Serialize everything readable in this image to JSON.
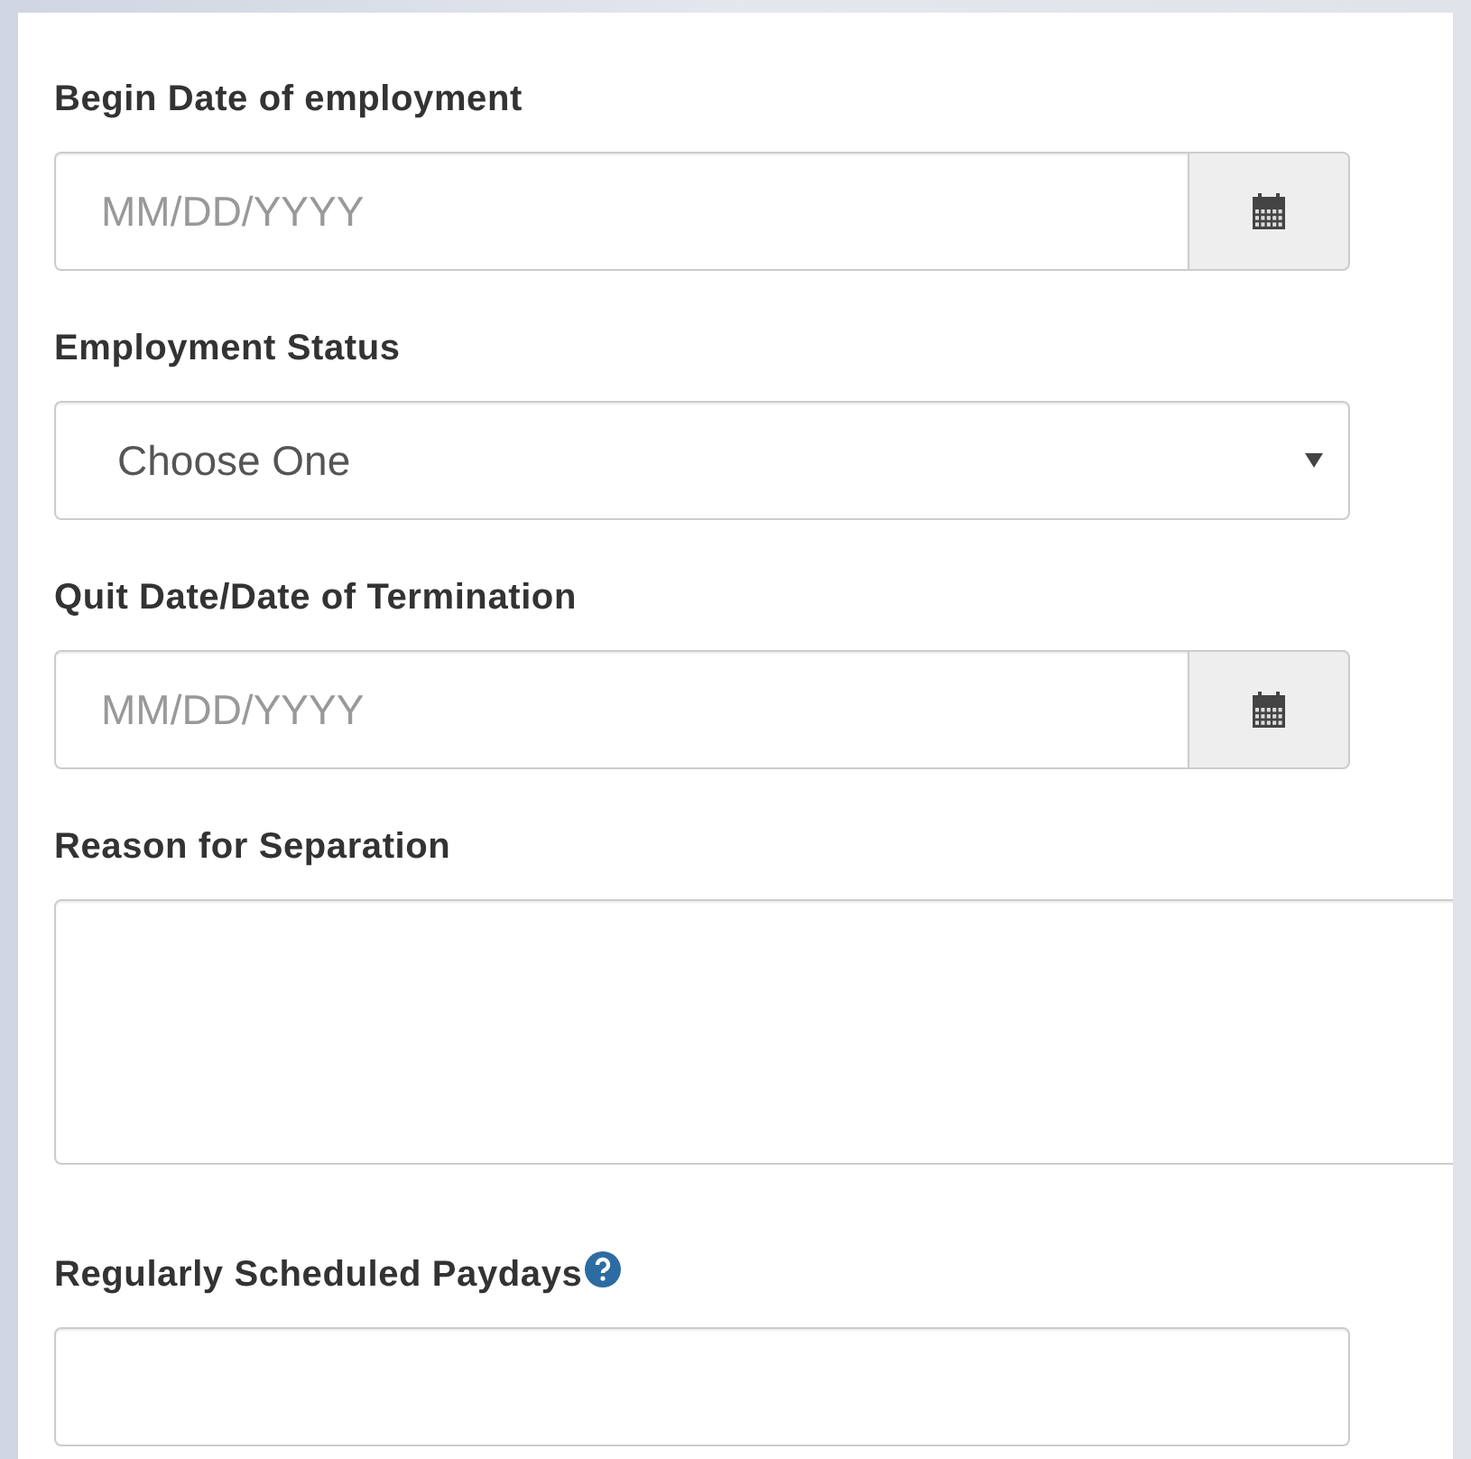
{
  "fields": [
    {
      "kind": "date",
      "label": "Begin Date of employment",
      "placeholder": "MM/DD/YYYY"
    },
    {
      "kind": "select",
      "label": "Employment Status",
      "value": "Choose One"
    },
    {
      "kind": "date",
      "label": "Quit Date/Date of Termination",
      "placeholder": "MM/DD/YYYY"
    },
    {
      "kind": "textarea",
      "label": "Reason for Separation"
    },
    {
      "kind": "text",
      "label": "Regularly Scheduled Paydays",
      "help": true
    }
  ]
}
